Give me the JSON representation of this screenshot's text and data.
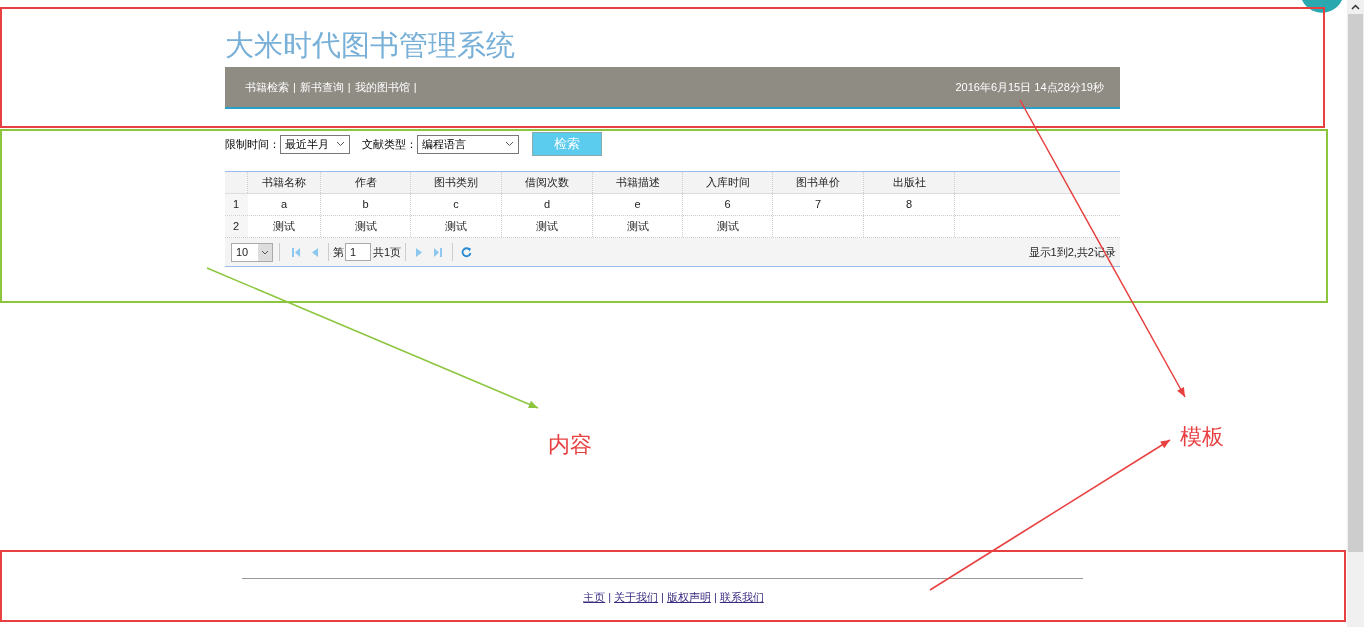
{
  "header": {
    "title": "大米时代图书管理系统",
    "nav": [
      "书籍检索",
      "新书查询",
      "我的图书馆"
    ],
    "separator": "|",
    "datetime": "2016年6月15日 14点28分19秒"
  },
  "filters": [
    {
      "label": "限制时间：",
      "value": "最近半月"
    },
    {
      "label": "文献类型：",
      "value": "编程语言"
    }
  ],
  "search_button": "检索",
  "table": {
    "columns": [
      "书籍名称",
      "作者",
      "图书类别",
      "借阅次数",
      "书籍描述",
      "入库时间",
      "图书单价",
      "出版社"
    ],
    "rows": [
      {
        "number": "1",
        "cells": [
          "a",
          "b",
          "c",
          "d",
          "e",
          "6",
          "7",
          "8"
        ]
      },
      {
        "number": "2",
        "cells": [
          "测试",
          "测试",
          "测试",
          "测试",
          "测试",
          "测试"
        ]
      }
    ]
  },
  "pager": {
    "page_size": "10",
    "before": "第",
    "page": "1",
    "after": "共1页",
    "summary": "显示1到2,共2记录"
  },
  "footer": {
    "links": [
      "主页",
      "关于我们",
      "版权声明",
      "联系我们"
    ],
    "separator": "|"
  },
  "annotations": [
    {
      "kind": "content",
      "label": "内容"
    },
    {
      "kind": "template",
      "label": "模板"
    }
  ]
}
